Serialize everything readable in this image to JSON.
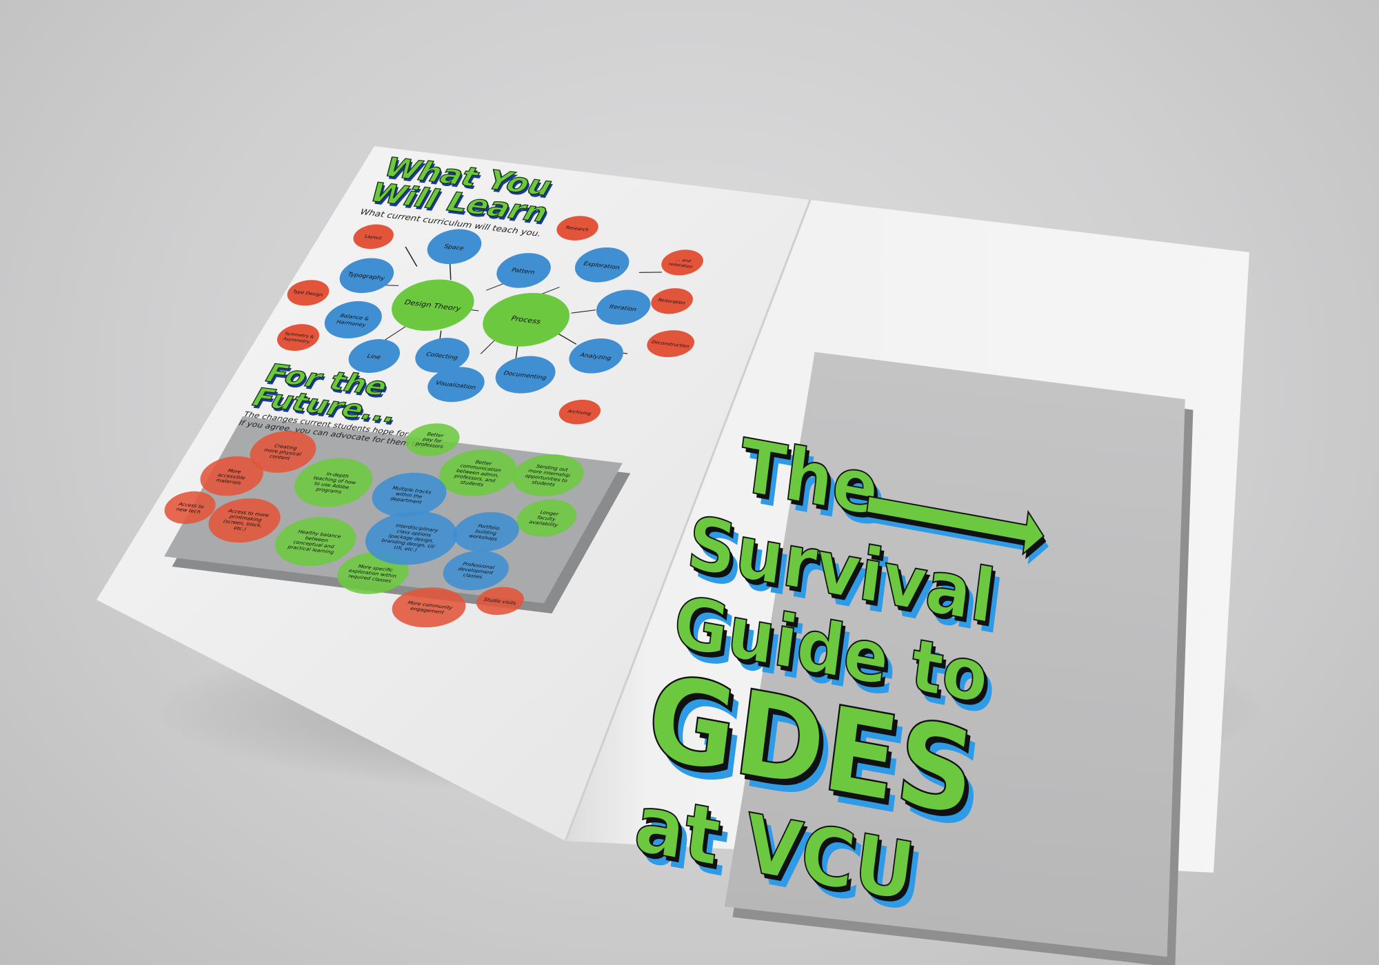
{
  "left_page": {
    "learn": {
      "title_line1": "What You",
      "title_line2": "Will Learn",
      "subtitle": "What current curriculum will teach you.",
      "hub_design_theory": "Design Theory",
      "hub_process": "Process",
      "nodes_blue": [
        "Space",
        "Pattern",
        "Typography",
        "Balance &",
        "Harmoney",
        "Line",
        "Collecting",
        "Exploration",
        "Iteration",
        "Analyzing",
        "Documenting",
        "Visualization"
      ],
      "nodes_red": [
        "Layout",
        "Type Design",
        "Symmetry &",
        "Asymmetry",
        "Research",
        "... and",
        "reiteration",
        "Reiteration",
        "Deconstruction",
        "Archiving"
      ]
    },
    "future": {
      "title_line1": "For the",
      "title_line2": "Future...",
      "subtitle_line1": "The changes current students hope for.",
      "subtitle_line2": "If you agree, you can advocate for them too.",
      "bubbles": [
        {
          "color": "red",
          "lines": [
            "Creating",
            "more physical",
            "content"
          ]
        },
        {
          "color": "red",
          "lines": [
            "More",
            "accessible",
            "materials"
          ]
        },
        {
          "color": "red",
          "lines": [
            "Access to",
            "new tech"
          ]
        },
        {
          "color": "red",
          "lines": [
            "Access to more",
            "printmaking",
            "(screen, block,",
            "etc.)"
          ]
        },
        {
          "color": "green",
          "lines": [
            "In-depth",
            "teaching of how",
            "to use Adobe",
            "programs"
          ]
        },
        {
          "color": "green",
          "lines": [
            "Healthy balance",
            "between",
            "conceptual and",
            "practical learning"
          ]
        },
        {
          "color": "green",
          "lines": [
            "More specific",
            "exploration within",
            "required classes"
          ]
        },
        {
          "color": "green",
          "lines": [
            "Better",
            "pay for",
            "professors"
          ]
        },
        {
          "color": "green",
          "lines": [
            "Better",
            "communication",
            "between admin,",
            "professors, and",
            "students"
          ]
        },
        {
          "color": "green",
          "lines": [
            "Sending out",
            "more internship",
            "opportunities to",
            "students"
          ]
        },
        {
          "color": "green",
          "lines": [
            "Longer",
            "faculty",
            "availability"
          ]
        },
        {
          "color": "blue",
          "lines": [
            "Multiple tracks",
            "within the",
            "department"
          ]
        },
        {
          "color": "blue",
          "lines": [
            "Interdisciplinary",
            "class options",
            "(package design,",
            "branding design, UI/",
            "UX, etc.)"
          ]
        },
        {
          "color": "blue",
          "lines": [
            "Portfolio",
            "building",
            "workshops"
          ]
        },
        {
          "color": "blue",
          "lines": [
            "Professional",
            "development",
            "classes"
          ]
        },
        {
          "color": "red",
          "lines": [
            "More community",
            "engagement"
          ]
        },
        {
          "color": "red",
          "lines": [
            "Studio visits"
          ]
        }
      ]
    }
  },
  "cover": {
    "line1": "The",
    "line2": "Survival",
    "line3": "Guide to",
    "line4": "GDES",
    "line5": "at VCU"
  },
  "colors": {
    "green": "#6cc93f",
    "blue": "#3f8fd2",
    "red": "#e2553a",
    "shadow_blue": "#2f9be6",
    "paper": "#f2f2f2",
    "panel_grey": "#a9aaab"
  }
}
